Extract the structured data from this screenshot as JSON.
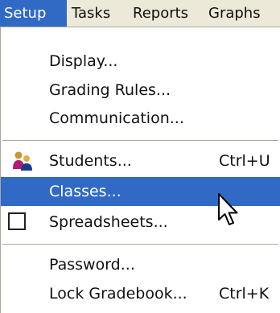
{
  "menubar": {
    "items": [
      {
        "label": "Setup",
        "active": true
      },
      {
        "label": "Tasks",
        "active": false
      },
      {
        "label": "Reports",
        "active": false
      },
      {
        "label": "Graphs",
        "active": false
      }
    ]
  },
  "menu": {
    "items": [
      {
        "label": "Display...",
        "shortcut": "",
        "icon": null,
        "highlighted": false
      },
      {
        "label": "Grading Rules...",
        "shortcut": "",
        "icon": null,
        "highlighted": false
      },
      {
        "label": "Communication...",
        "shortcut": "",
        "icon": null,
        "highlighted": false
      },
      {
        "label": "Students...",
        "shortcut": "Ctrl+U",
        "icon": "students-icon",
        "highlighted": false
      },
      {
        "label": "Classes...",
        "shortcut": "",
        "icon": null,
        "highlighted": true
      },
      {
        "label": "Spreadsheets...",
        "shortcut": "",
        "icon": "checkbox-icon",
        "highlighted": false
      },
      {
        "label": "Password...",
        "shortcut": "",
        "icon": null,
        "highlighted": false
      },
      {
        "label": "Lock Gradebook...",
        "shortcut": "Ctrl+K",
        "icon": null,
        "highlighted": false
      }
    ]
  },
  "colors": {
    "highlight": "#316ac5",
    "menubar_bg": "#ece9d8"
  }
}
